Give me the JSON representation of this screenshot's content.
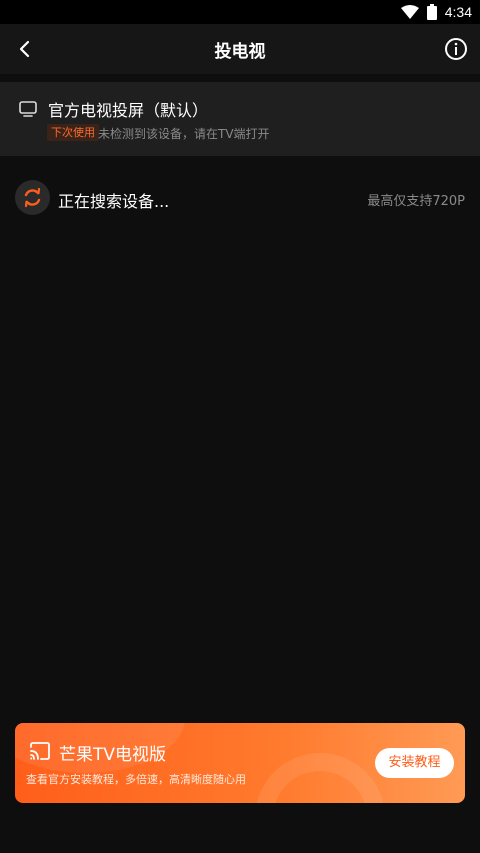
{
  "status_bar": {
    "time": "4:34"
  },
  "header": {
    "title": "投电视"
  },
  "official": {
    "title": "官方电视投屏（默认）",
    "badge": "下次使用",
    "subtitle": "未检测到该设备，请在TV端打开"
  },
  "search": {
    "text": "正在搜索设备...",
    "hint": "最高仅支持720P"
  },
  "promo": {
    "title": "芒果TV电视版",
    "subtitle": "查看官方安装教程，多倍速，高清晰度随心用",
    "button": "安装教程"
  },
  "colors": {
    "accent": "#ff5e1a",
    "background": "#0e0e0e",
    "muted_text": "#8a8a8a"
  },
  "icons": {
    "back": "chevron-left-icon",
    "info": "info-icon",
    "tv": "tv-icon",
    "spinner": "refresh-icon",
    "cast": "cast-icon",
    "wifi": "wifi-icon",
    "battery": "battery-icon"
  }
}
